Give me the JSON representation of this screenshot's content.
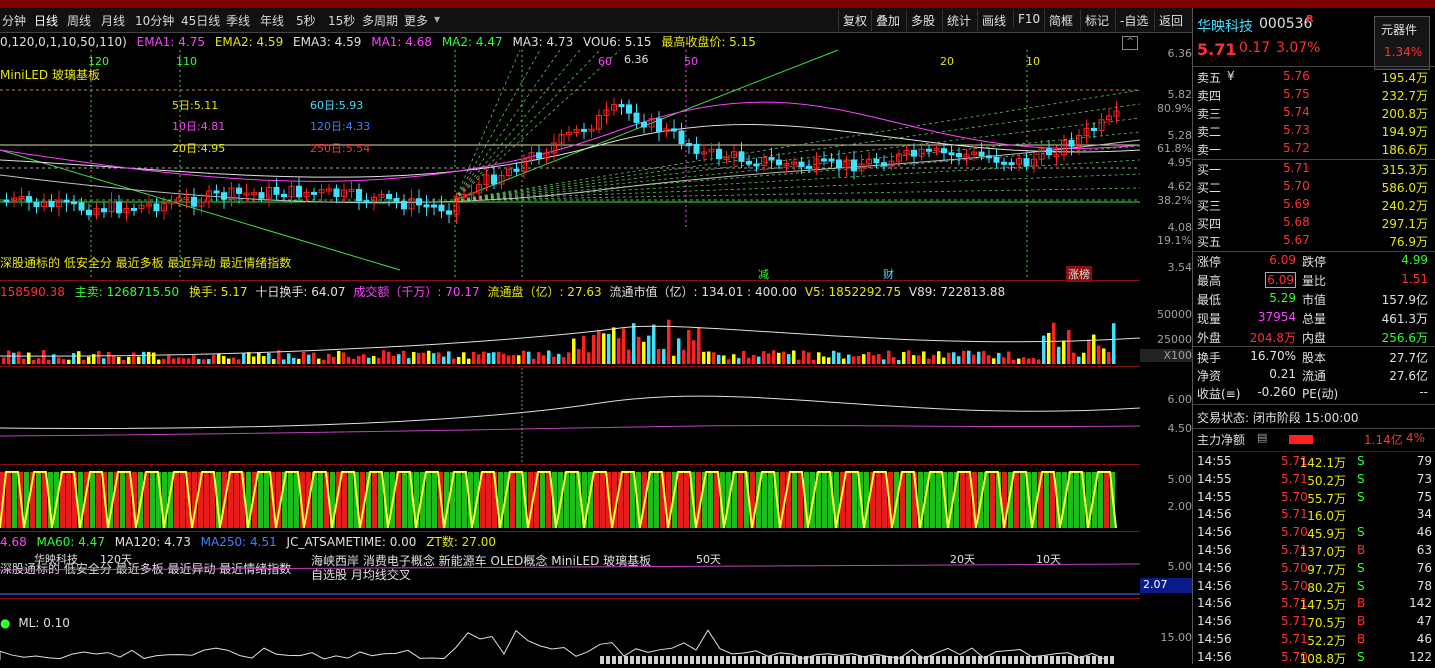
{
  "toolbar": {
    "periods": [
      "分钟",
      "日线",
      "周线",
      "月线",
      "10分钟",
      "45日线",
      "季线",
      "年线",
      "5秒",
      "15秒",
      "多周期",
      "更多"
    ],
    "actions": [
      "复权",
      "叠加",
      "多股",
      "统计",
      "画线",
      "F10",
      "简框",
      "标记",
      "-自选",
      "返回"
    ]
  },
  "indicator_bar": {
    "params": "0,120,0,1,10,50,110)",
    "ema1": "EMA1: 4.75",
    "ema2": "EMA2: 4.59",
    "ema3": "EMA3: 4.59",
    "ma1": "MA1: 4.68",
    "ma2": "MA2: 4.47",
    "ma3": "MA3: 4.73",
    "vou": "VOU6: 5.15",
    "maxclose": "最高收盘价: 5.15"
  },
  "chart_labels": {
    "concept": "MiniLED 玻璃基板",
    "n120": "120",
    "n110": "110",
    "n60": "60",
    "n636": "6.36",
    "n50": "50",
    "n20": "20",
    "n10": "10",
    "d5": "5日:5.11",
    "d60": "60日:5.93",
    "d10": "10日:4.81",
    "d120": "120日:4.33",
    "d20": "20日:4.95",
    "d250": "250日:5.54",
    "tags": "深股通标的 低安全分 最近多板 最近异动 最近情绪指数",
    "mark1": "减",
    "mark2": "财",
    "mark3": "涨榜"
  },
  "price_axis": [
    "6.36",
    "5.82",
    "80.9%",
    "5.28",
    "61.8%",
    "4.95",
    "4.62",
    "38.2%",
    "4.08",
    "19.1%",
    "3.54"
  ],
  "volume_bar": {
    "a": "158590.38",
    "main_sell": "主卖: 1268715.50",
    "turnover": "换手: 5.17",
    "ten_day": "十日换手: 64.07",
    "amount": "成交额（千万）: 70.17",
    "float_cap": "流通盘（亿）: 27.63",
    "float_value": "流通市值（亿）: 134.01 : 400.00",
    "v5": "V5: 1852292.75",
    "v89": "V89: 722813.88"
  },
  "volume_axis": [
    "50000",
    "25000",
    "X100"
  ],
  "mid_axis": [
    "6.00",
    "4.50"
  ],
  "osc_axis": [
    "5.00",
    "2.00"
  ],
  "ma_bar": {
    "ma1": "4.68",
    "ma60": "MA60: 4.47",
    "ma120": "MA120: 4.73",
    "ma250": "MA250: 4.51",
    "jc": "JC_ATSAMETIME: 0.00",
    "zt": "ZT数: 27.00"
  },
  "bottom_tags": {
    "stock": "华映科技",
    "t120": "120天",
    "t50": "50天",
    "t20": "20天",
    "t10": "10天",
    "concepts": "海峡西岸 消费电子概念 新能源车 OLED概念 MiniLED 玻璃基板",
    "line2": "自选股 月均线交叉",
    "tags": "深股通标的 低安全分 最近多板 最近异动 最近情绪指数",
    "axis": "5.00",
    "val": "2.07"
  },
  "ml_bar": {
    "ml": "ML: 0.10",
    "axis": "15.00"
  },
  "quote": {
    "name": "华映科技",
    "code": "000536",
    "flag": "R",
    "sector": "元器件",
    "sector_pct": "1.34%",
    "price": "5.71",
    "change": "0.17",
    "pct": "3.07%",
    "asks": [
      {
        "label": "卖五",
        "price": "5.76",
        "vol": "195.4万"
      },
      {
        "label": "卖四",
        "price": "5.75",
        "vol": "232.7万"
      },
      {
        "label": "卖三",
        "price": "5.74",
        "vol": "200.8万"
      },
      {
        "label": "卖二",
        "price": "5.73",
        "vol": "194.9万"
      },
      {
        "label": "卖一",
        "price": "5.72",
        "vol": "186.6万"
      }
    ],
    "bids": [
      {
        "label": "买一",
        "price": "5.71",
        "vol": "315.3万"
      },
      {
        "label": "买二",
        "price": "5.70",
        "vol": "586.0万"
      },
      {
        "label": "买三",
        "price": "5.69",
        "vol": "240.2万"
      },
      {
        "label": "买四",
        "price": "5.68",
        "vol": "297.1万"
      },
      {
        "label": "买五",
        "price": "5.67",
        "vol": "76.9万"
      }
    ],
    "stats": [
      {
        "l1": "涨停",
        "v1": "6.09",
        "l2": "跌停",
        "v2": "4.99"
      },
      {
        "l1": "最高",
        "v1": "6.09",
        "l2": "量比",
        "v2": "1.51"
      },
      {
        "l1": "最低",
        "v1": "5.29",
        "l2": "市值",
        "v2": "157.9亿"
      },
      {
        "l1": "现量",
        "v1": "37954",
        "l2": "总量",
        "v2": "461.3万"
      },
      {
        "l1": "外盘",
        "v1": "204.8万",
        "l2": "内盘",
        "v2": "256.6万"
      }
    ],
    "stats2": [
      {
        "l1": "换手",
        "v1": "16.70%",
        "l2": "股本",
        "v2": "27.7亿"
      },
      {
        "l1": "净资",
        "v1": "0.21",
        "l2": "流通",
        "v2": "27.6亿"
      },
      {
        "l1": "收益(≡)",
        "v1": "-0.260",
        "l2": "PE(动)",
        "v2": "--"
      }
    ],
    "status": "交易状态: 闭市阶段 15:00:00",
    "main_flow_label": "主力净额",
    "main_flow": "1.14亿",
    "main_flow_pct": "4%"
  },
  "trades": [
    {
      "t": "14:55",
      "p": "5.71",
      "v": "142.1万",
      "s": "S",
      "n": "79"
    },
    {
      "t": "14:55",
      "p": "5.71",
      "v": "50.2万",
      "s": "S",
      "n": "73"
    },
    {
      "t": "14:55",
      "p": "5.70",
      "v": "55.7万",
      "s": "S",
      "n": "75"
    },
    {
      "t": "14:56",
      "p": "5.71",
      "v": "16.0万",
      "s": "",
      "n": "34"
    },
    {
      "t": "14:56",
      "p": "5.70",
      "v": "45.9万",
      "s": "S",
      "n": "46"
    },
    {
      "t": "14:56",
      "p": "5.71",
      "v": "137.0万",
      "s": "B",
      "n": "63"
    },
    {
      "t": "14:56",
      "p": "5.70",
      "v": "97.7万",
      "s": "S",
      "n": "76"
    },
    {
      "t": "14:56",
      "p": "5.70",
      "v": "80.2万",
      "s": "S",
      "n": "78"
    },
    {
      "t": "14:56",
      "p": "5.71",
      "v": "147.5万",
      "s": "B",
      "n": "142"
    },
    {
      "t": "14:56",
      "p": "5.71",
      "v": "70.5万",
      "s": "B",
      "n": "47"
    },
    {
      "t": "14:56",
      "p": "5.71",
      "v": "52.2万",
      "s": "B",
      "n": "46"
    },
    {
      "t": "14:56",
      "p": "5.70",
      "v": "108.8万",
      "s": "S",
      "n": "122"
    }
  ]
}
